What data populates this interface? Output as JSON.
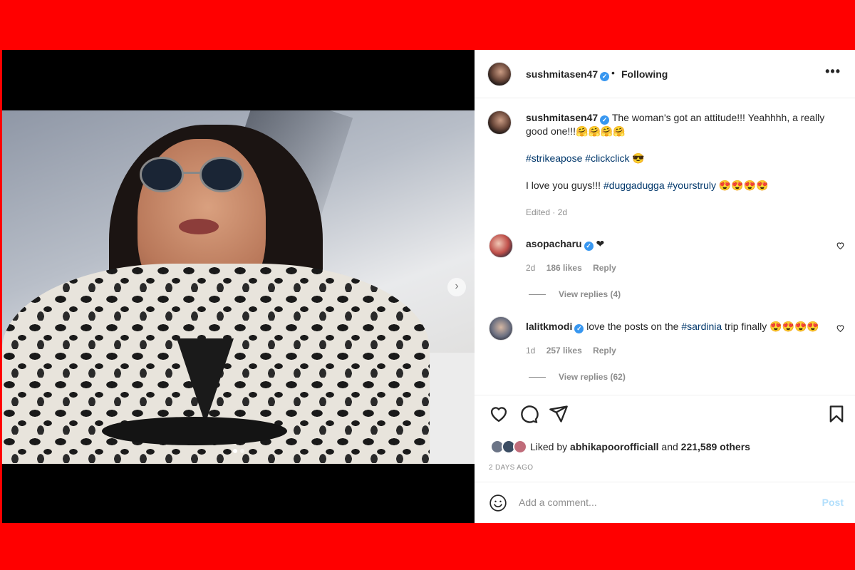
{
  "post": {
    "author": "sushmitasen47",
    "follow_sep": "•",
    "follow_state": "Following",
    "more": "•••",
    "caption_line1": "The woman's got an attitude!!! Yeahhhh, a really good one!!!🤗🤗🤗🤗",
    "caption_tags1a": "#strikeapose",
    "caption_tags1b": "#clickclick",
    "caption_tags1c": " 😎",
    "caption_line3": "I love you guys!!! ",
    "caption_tags2a": "#duggadugga",
    "caption_tags2b": "#yourstruly",
    "caption_tags2c": " 😍😍😍😍",
    "edited": "Edited · 2d"
  },
  "comments": [
    {
      "user": "asopacharu",
      "text": "❤",
      "age": "2d",
      "likes": "186 likes",
      "reply": "Reply",
      "view_replies": "View replies (4)"
    },
    {
      "user": "lalitkmodi",
      "text_pre": "love the posts on the ",
      "tag": "#sardinia",
      "text_post": " trip finally 😍😍😍😍",
      "age": "1d",
      "likes": "257 likes",
      "reply": "Reply",
      "view_replies": "View replies (62)"
    }
  ],
  "likes": {
    "prefix": "Liked by ",
    "user": "abhikapoorofficiall",
    "mid": " and ",
    "others": "221,589 others"
  },
  "posted": "2 DAYS AGO",
  "add_comment": {
    "placeholder": "Add a comment...",
    "post_label": "Post"
  },
  "carousel": {
    "next": "›",
    "slide_count": 2,
    "active_slide": 1
  },
  "colors": {
    "background": "#ff0000",
    "link": "#00376b",
    "verified": "#3897f0",
    "post_disabled": "#b2dffc"
  }
}
